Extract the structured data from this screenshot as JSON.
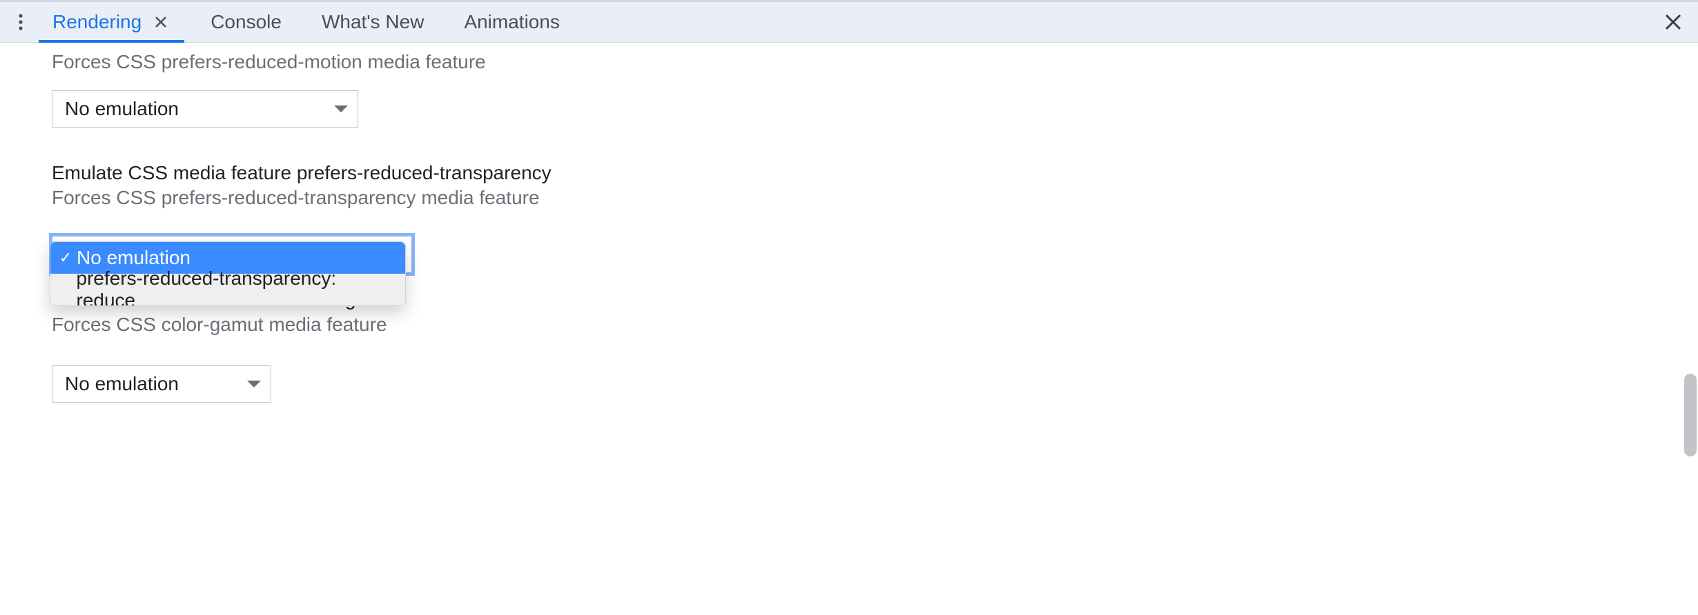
{
  "tabs": {
    "items": [
      {
        "label": "Rendering",
        "active": true,
        "closable": true
      },
      {
        "label": "Console",
        "active": false,
        "closable": false
      },
      {
        "label": "What's New",
        "active": false,
        "closable": false
      },
      {
        "label": "Animations",
        "active": false,
        "closable": false
      }
    ]
  },
  "sections": {
    "reducedMotion": {
      "desc": "Forces CSS prefers-reduced-motion media feature",
      "selectValue": "No emulation"
    },
    "reducedTransparency": {
      "title": "Emulate CSS media feature prefers-reduced-transparency",
      "desc": "Forces CSS prefers-reduced-transparency media feature",
      "selectValue": "No emulation",
      "options": [
        "No emulation",
        "prefers-reduced-transparency: reduce"
      ],
      "selectedIndex": 0
    },
    "colorGamut": {
      "title": "Emulate CSS media feature color-gamut",
      "desc": "Forces CSS color-gamut media feature",
      "selectValue": "No emulation"
    }
  }
}
